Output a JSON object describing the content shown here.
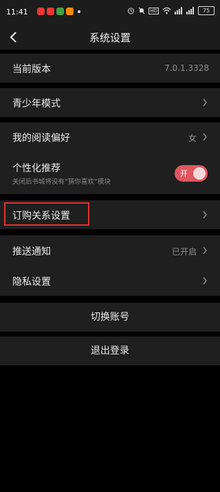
{
  "status": {
    "time": "11:41",
    "battery": "75",
    "app_colors": [
      "#e53935",
      "#e53935",
      "#43a047",
      "#fb8c00"
    ]
  },
  "nav": {
    "title": "系统设置"
  },
  "rows": {
    "version": {
      "label": "当前版本",
      "value": "7.0.1.3328"
    },
    "youth": {
      "label": "青少年模式"
    },
    "reading": {
      "label": "我的阅读偏好",
      "value": "女"
    },
    "personal": {
      "label": "个性化推荐",
      "sub": "关闭后书城将没有“猜你喜欢”模块",
      "toggle_text": "开",
      "toggle_on": true
    },
    "subscription": {
      "label": "订购关系设置"
    },
    "push": {
      "label": "推送通知",
      "value": "已开启"
    },
    "privacy": {
      "label": "隐私设置"
    }
  },
  "buttons": {
    "switch_account": "切换账号",
    "logout": "退出登录"
  },
  "colors": {
    "toggle": "#e0575f",
    "highlight": "#e0322f"
  }
}
